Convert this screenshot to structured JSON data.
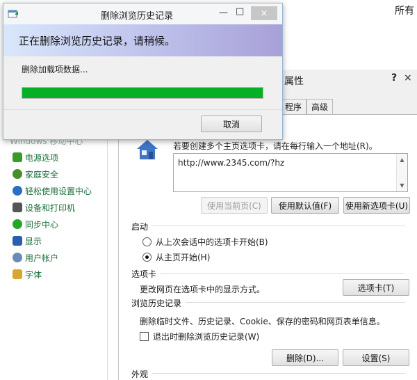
{
  "control_panel": {
    "top_right_text": "所有",
    "sidebar_partial": "Windows 移动中心",
    "sidebar_items": [
      {
        "label": "电源选项",
        "color": "#3a9a2a"
      },
      {
        "label": "家庭安全",
        "color": "#4b8d2c"
      },
      {
        "label": "轻松使用设置中心",
        "color": "#2a6fc2"
      },
      {
        "label": "设备和打印机",
        "color": "#555555"
      },
      {
        "label": "同步中心",
        "color": "#29a329"
      },
      {
        "label": "显示",
        "color": "#2a5fb0"
      },
      {
        "label": "用户帐户",
        "color": "#6a8bb5"
      },
      {
        "label": "字体",
        "color": "#d9a431"
      }
    ]
  },
  "internet_options": {
    "title_partial": "属性",
    "help": "?",
    "close": "×",
    "tabs": [
      "程序",
      "高级"
    ],
    "homepage_hint": "若要创建多个主页选项卡，请在每行输入一个地址(R)。",
    "homepage_url": "http://www.2345.com/?hz",
    "buttons": {
      "use_current": "使用当前页(C)",
      "use_default": "使用默认值(F)",
      "use_new_tab": "使用新选项卡(U)"
    },
    "startup": {
      "label": "启动",
      "option_last_session": "从上次会话中的选项卡开始(B)",
      "option_homepage": "从主页开始(H)",
      "selected": "option_homepage"
    },
    "tabs_section": {
      "label": "选项卡",
      "description": "更改网页在选项卡中的显示方式。",
      "button": "选项卡(T)"
    },
    "history": {
      "label": "浏览历史记录",
      "description": "删除临时文件、历史记录、Cookie、保存的密码和网页表单信息。",
      "checkbox_label": "退出时删除浏览历史记录(W)",
      "checked": false,
      "delete_button": "删除(D)...",
      "settings_button": "设置(S)"
    },
    "appearance_label": "外观"
  },
  "delete_dialog": {
    "title": "删除浏览历史记录",
    "heading": "正在删除浏览历史记录，请稍候。",
    "status": "删除加载项数据...",
    "progress": 1.0,
    "progress_color": "#06b025",
    "cancel_label": "取消",
    "minimize": "—",
    "maximize": "□",
    "close": "×"
  }
}
